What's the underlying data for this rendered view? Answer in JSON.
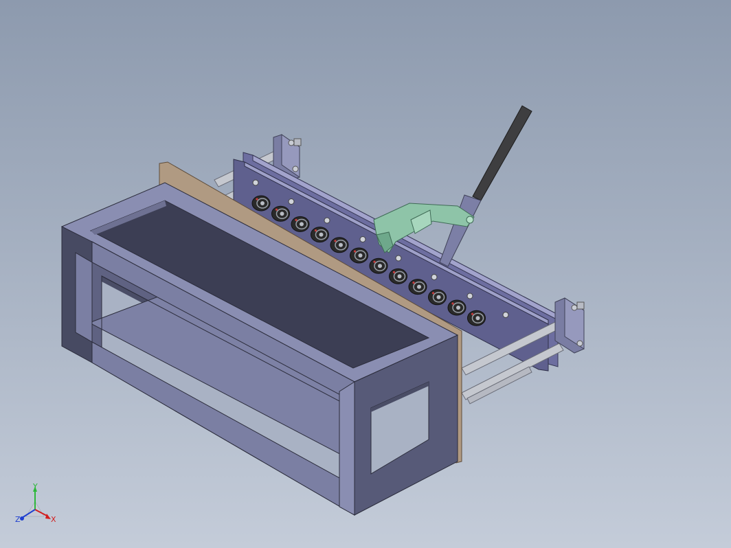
{
  "triad": {
    "x_label": "X",
    "y_label": "Y",
    "z_label": "Z",
    "x_color": "#d21e1e",
    "y_color": "#2db83a",
    "z_color": "#1f3fcf"
  },
  "model": {
    "frame_color": "#7b7fa3",
    "frame_dark": "#4d5066",
    "plate_color": "#6a5a4c",
    "roller_color": "#2a2a2a",
    "bracket_color": "#8dc4a8",
    "rail_color": "#7677a8",
    "handle_color": "#3c3c3c",
    "roller_count": 12,
    "hole_count": 10
  }
}
